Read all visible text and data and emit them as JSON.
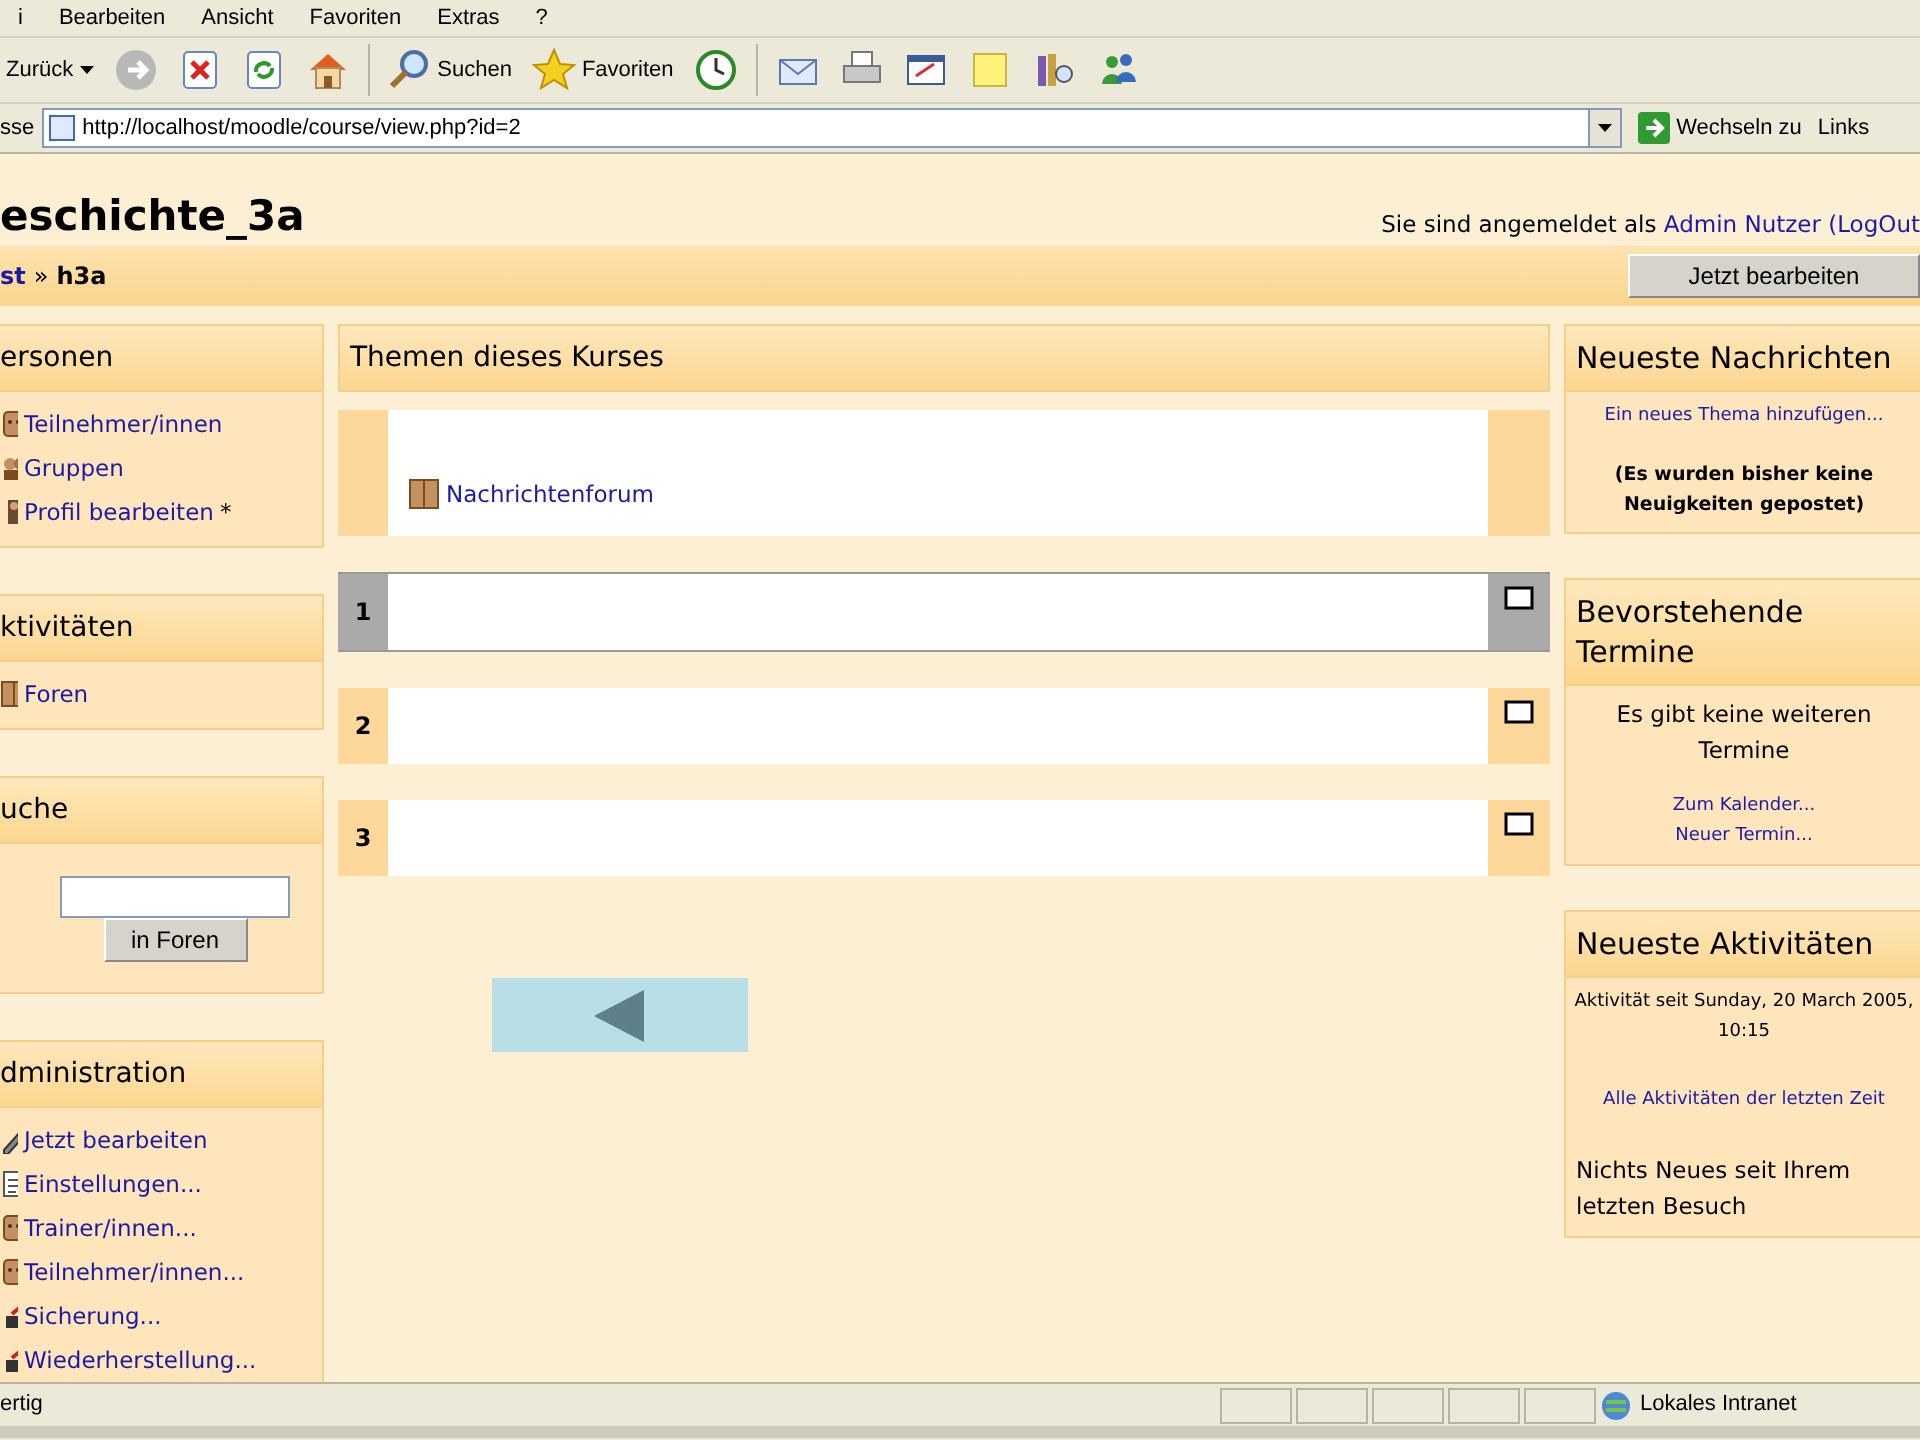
{
  "menu_bar": [
    "i",
    "Bearbeiten",
    "Ansicht",
    "Favoriten",
    "Extras",
    "?"
  ],
  "toolbar": [
    {
      "kind": "back",
      "label": "Zurück"
    },
    {
      "kind": "forward"
    },
    {
      "kind": "stop"
    },
    {
      "kind": "refresh"
    },
    {
      "kind": "home"
    },
    {
      "kind": "search",
      "label": "Suchen"
    },
    {
      "kind": "favorites",
      "label": "Favoriten"
    },
    {
      "kind": "history"
    },
    {
      "kind": "mail"
    },
    {
      "kind": "print"
    },
    {
      "kind": "edit"
    },
    {
      "kind": "note"
    },
    {
      "kind": "research"
    },
    {
      "kind": "messenger"
    }
  ],
  "address_bar": {
    "label": "sse",
    "url": "http://localhost/moodle/course/view.php?id=2",
    "go": "Wechseln zu",
    "links": "Links"
  },
  "header": {
    "title": "eschichte_3a",
    "login_text": "Sie sind angemeldet als",
    "user": "Admin Nutzer",
    "logout": "(LogOut"
  },
  "breadcrumb": {
    "items": [
      {
        "text": "st",
        "link": true
      },
      {
        "text": "h3a",
        "link": false
      }
    ],
    "separator": "»",
    "edit_button": "Jetzt bearbeiten"
  },
  "left_blocks": [
    {
      "kind": "links",
      "title": "ersonen",
      "items": [
        {
          "kind": "person",
          "text": "Teilnehmer/innen"
        },
        {
          "kind": "group",
          "text": "Gruppen"
        },
        {
          "kind": "profile",
          "text": "Profil bearbeiten",
          "note": "*"
        }
      ]
    },
    {
      "kind": "links",
      "title": "ktivitäten",
      "items": [
        {
          "kind": "forum",
          "text": "Foren"
        }
      ]
    },
    {
      "kind": "search",
      "title": "uche",
      "button": "in Foren"
    },
    {
      "kind": "links",
      "title": "dministration",
      "items": [
        {
          "kind": "edit",
          "text": "Jetzt bearbeiten"
        },
        {
          "kind": "settings",
          "text": "Einstellungen..."
        },
        {
          "kind": "person",
          "text": "Trainer/innen..."
        },
        {
          "kind": "person",
          "text": "Teilnehmer/innen..."
        },
        {
          "kind": "backup",
          "text": "Sicherung..."
        },
        {
          "kind": "restore",
          "text": "Wiederherstellung..."
        }
      ]
    }
  ],
  "topics": {
    "title": "Themen dieses Kurses",
    "sections": [
      {
        "kind": "general",
        "highlighted": false,
        "activities": [
          "Nachrichtenforum"
        ]
      },
      {
        "kind": "topic",
        "number": "1",
        "highlighted": true
      },
      {
        "kind": "topic",
        "number": "2",
        "highlighted": false
      },
      {
        "kind": "topic",
        "number": "3",
        "highlighted": false
      }
    ]
  },
  "right_blocks": [
    {
      "title": "Neueste Nachrichten",
      "lines": [
        {
          "kind": "smalllink",
          "text": "Ein neues Thema hinzufügen..."
        },
        {
          "kind": "bold",
          "text": "(Es wurden bisher keine Neuigkeiten gepostet)"
        }
      ]
    },
    {
      "title": "Bevorstehende Termine",
      "lines": [
        {
          "kind": "center",
          "text": "Es gibt keine weiteren Termine"
        },
        {
          "kind": "smalllink",
          "text": "Zum Kalender..."
        },
        {
          "kind": "smalllink",
          "text": "Neuer Termin..."
        }
      ]
    },
    {
      "title": "Neueste Aktivitäten",
      "lines": [
        {
          "kind": "small",
          "text": "Aktivität seit Sunday, 20 March 2005, 10:15"
        },
        {
          "kind": "smalllink",
          "text": "Alle Aktivitäten der letzten Zeit"
        },
        {
          "kind": "plain",
          "text": "Nichts Neues seit Ihrem letzten Besuch"
        }
      ]
    }
  ],
  "status_bar": {
    "text": "ertig",
    "zone": "Lokales Intranet"
  }
}
